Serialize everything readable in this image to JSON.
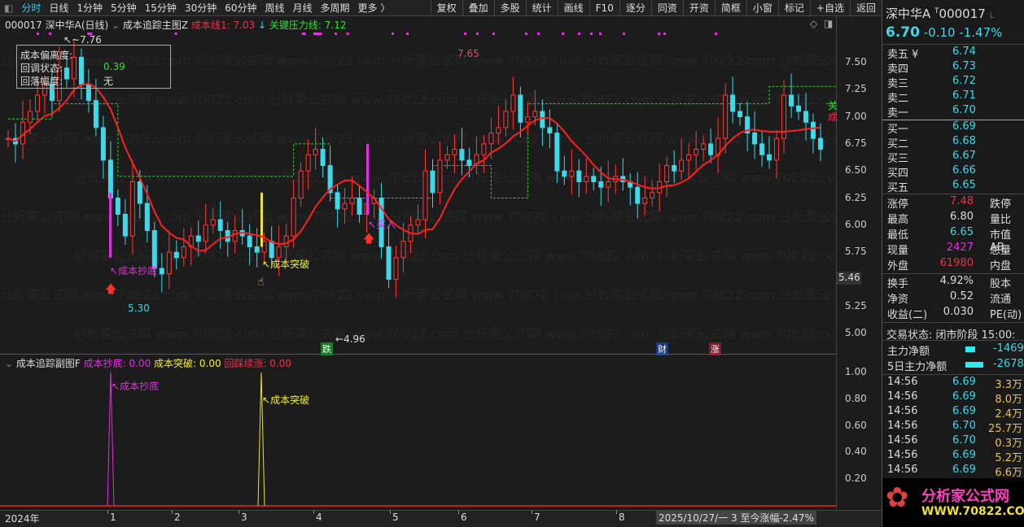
{
  "toolbar": {
    "left": [
      "分时",
      "日线",
      "1分钟",
      "5分钟",
      "15分钟",
      "30分钟",
      "60分钟",
      "周线",
      "月线",
      "多周期",
      "更多 〉"
    ],
    "right": [
      "复权",
      "叠加",
      "多股",
      "统计",
      "画线",
      "F10",
      "逐分",
      "同资",
      "开资",
      "简框",
      "小窗",
      "标记",
      "+自选",
      "返回"
    ]
  },
  "info": {
    "code_name": "000017 深中华A(日线)",
    "indicator": "成本追踪主图Z",
    "cost_line": "成本线1: 7.03",
    "pressure": "关键压力线: 7.12"
  },
  "infobox": {
    "l1": "成本偏离度:",
    "l2": "回调状态:",
    "l3": "回落幅度:",
    "v2": "0.39",
    "v3": "无"
  },
  "labels": {
    "high1": "7.76",
    "high2": "7.65",
    "low1": "5.30",
    "low2": "4.96",
    "dip": "成本抄底",
    "break": "成本突破",
    "buy": "买入",
    "die": "跌",
    "cai": "财",
    "zhang": "涨",
    "guan": "关",
    "cheng": "成",
    "price_tag": "5.46"
  },
  "sub": {
    "title": "成本追踪副图F",
    "a": "成本抄底: 0.00",
    "b": "成本突破: 0.00",
    "c": "回踩续涨: 0.00",
    "dip": "成本抄底",
    "break": "成本突破",
    "ticks": [
      "1.00",
      "0.80",
      "0.60",
      "0.40",
      "0.20"
    ]
  },
  "yticks": [
    "7.50",
    "7.25",
    "7.00",
    "6.75",
    "6.50",
    "6.25",
    "6.00",
    "5.75",
    "5.25",
    "5.00"
  ],
  "xaxis": {
    "labels": [
      "2024年",
      "1",
      "2",
      "3",
      "4",
      "5",
      "6",
      "7",
      "8"
    ],
    "status": "2025/10/27/一 3 至今涨幅-2.47%"
  },
  "quote": {
    "name": "深中华A",
    "code": "000017",
    "price": "6.70",
    "change": "-0.10",
    "pct": "-1.47%"
  },
  "asks": [
    {
      "l": "卖五 ¥",
      "v": "6.74"
    },
    {
      "l": "卖四",
      "v": "6.73"
    },
    {
      "l": "卖三",
      "v": "6.72"
    },
    {
      "l": "卖二",
      "v": "6.71"
    },
    {
      "l": "卖一",
      "v": "6.70"
    }
  ],
  "bids": [
    {
      "l": "买一",
      "v": "6.69"
    },
    {
      "l": "买二",
      "v": "6.68"
    },
    {
      "l": "买三",
      "v": "6.67"
    },
    {
      "l": "买四",
      "v": "6.66"
    },
    {
      "l": "买五",
      "v": "6.65"
    }
  ],
  "stats": [
    {
      "l": "涨停",
      "v": "7.48",
      "r": "跌停"
    },
    {
      "l": "最高",
      "v": "6.80",
      "r": "量比"
    },
    {
      "l": "最低",
      "v": "6.65",
      "r": "市值AB"
    },
    {
      "l": "现量",
      "v": "2427",
      "r": "总量"
    },
    {
      "l": "外盘",
      "v": "61980",
      "r": "内盘"
    },
    {
      "l": "换手",
      "v": "4.92%",
      "r": "股本"
    },
    {
      "l": "净资",
      "v": "0.52",
      "r": "流通"
    },
    {
      "l": "收益(二)",
      "v": "0.030",
      "r": "PE(动)"
    }
  ],
  "trade_status": "交易状态: 闭市阶段 15:00:",
  "flow": [
    {
      "l": "主力净额",
      "v": "-1469"
    },
    {
      "l": "5日主力净额",
      "v": "-2678"
    }
  ],
  "ticks": [
    {
      "t": "14:56",
      "p": "6.69",
      "q": "3.3万"
    },
    {
      "t": "14:56",
      "p": "6.69",
      "q": "8.0万"
    },
    {
      "t": "14:56",
      "p": "6.69",
      "q": "2.4万"
    },
    {
      "t": "14:56",
      "p": "6.70",
      "q": "25.7万"
    },
    {
      "t": "14:56",
      "p": "6.70",
      "q": "0.3万"
    },
    {
      "t": "14:56",
      "p": "6.69",
      "q": "5.2万"
    },
    {
      "t": "14:56",
      "p": "6.69",
      "q": "6.6万"
    }
  ],
  "watermark": {
    "name": "分析家公式网",
    "url": "WWW.70822.COM"
  },
  "chart_data": {
    "type": "candlestick",
    "ylim": [
      4.9,
      7.8
    ],
    "closes": [
      6.8,
      6.75,
      6.95,
      7.05,
      7.2,
      7.3,
      7.15,
      7.45,
      7.35,
      7.55,
      7.3,
      7.15,
      6.9,
      6.6,
      6.25,
      6.1,
      5.9,
      6.4,
      6.2,
      5.95,
      5.6,
      5.55,
      5.75,
      5.7,
      5.8,
      5.9,
      5.85,
      6.0,
      6.05,
      5.95,
      5.85,
      5.95,
      5.9,
      5.8,
      5.75,
      5.85,
      5.7,
      5.8,
      5.9,
      6.25,
      6.5,
      6.65,
      6.7,
      6.55,
      6.3,
      6.15,
      6.2,
      6.25,
      6.1,
      6.2,
      6.25,
      5.8,
      5.5,
      5.7,
      5.85,
      6.0,
      6.05,
      6.5,
      6.3,
      6.6,
      6.65,
      6.7,
      6.6,
      6.55,
      6.65,
      6.75,
      6.85,
      6.9,
      7.05,
      7.2,
      6.95,
      7.0,
      7.05,
      6.9,
      6.85,
      6.5,
      6.45,
      6.5,
      6.4,
      6.45,
      6.4,
      6.35,
      6.4,
      6.45,
      6.4,
      6.35,
      6.2,
      6.25,
      6.3,
      6.4,
      6.55,
      6.5,
      6.6,
      6.65,
      6.7,
      6.75,
      6.65,
      6.8,
      7.2,
      7.05,
      7.0,
      6.85,
      6.75,
      6.65,
      6.6,
      6.8,
      7.2,
      7.1,
      7.05,
      6.95,
      6.8,
      6.7
    ],
    "pressure_steps": [
      [
        0,
        6.98
      ],
      [
        6,
        7.12
      ],
      [
        15,
        6.45
      ],
      [
        39,
        6.75
      ],
      [
        44,
        6.25
      ],
      [
        58,
        6.55
      ],
      [
        66,
        6.25
      ],
      [
        71,
        7.12
      ],
      [
        104,
        7.28
      ],
      [
        114,
        7.12
      ]
    ]
  }
}
